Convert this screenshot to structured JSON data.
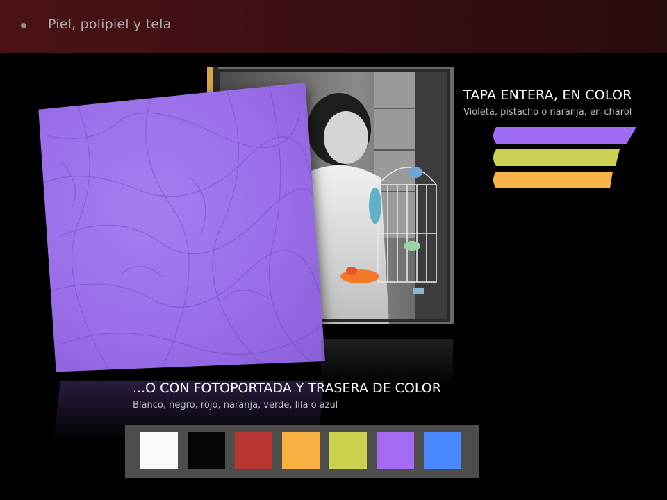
{
  "header": {
    "title": "Piel, polipiel y tela"
  },
  "right_panel": {
    "heading": "TAPA ENTERA, EN COLOR",
    "subtitle": "Violeta, pistacho o naranja, en charol",
    "strips": [
      {
        "name": "violeta",
        "color": "#9f6bf2"
      },
      {
        "name": "pistacho",
        "color": "#cdd153"
      },
      {
        "name": "naranja",
        "color": "#f9b248"
      }
    ]
  },
  "bottom_panel": {
    "heading": "...O CON FOTOPORTADA Y TRASERA DE COLOR",
    "subtitle": "Blanco, negro, rojo, naranja, verde, lila o azul",
    "colors": [
      {
        "name": "blanco",
        "color": "#fafafa"
      },
      {
        "name": "negro",
        "color": "#050505"
      },
      {
        "name": "rojo",
        "color": "#b83632"
      },
      {
        "name": "naranja",
        "color": "#f9b041"
      },
      {
        "name": "verde",
        "color": "#cdd150"
      },
      {
        "name": "lila",
        "color": "#a56bf2"
      },
      {
        "name": "azul",
        "color": "#4a88ff"
      }
    ]
  },
  "colors": {
    "title_bar": "#4a1216",
    "violet_album": "#9a6fe8"
  }
}
